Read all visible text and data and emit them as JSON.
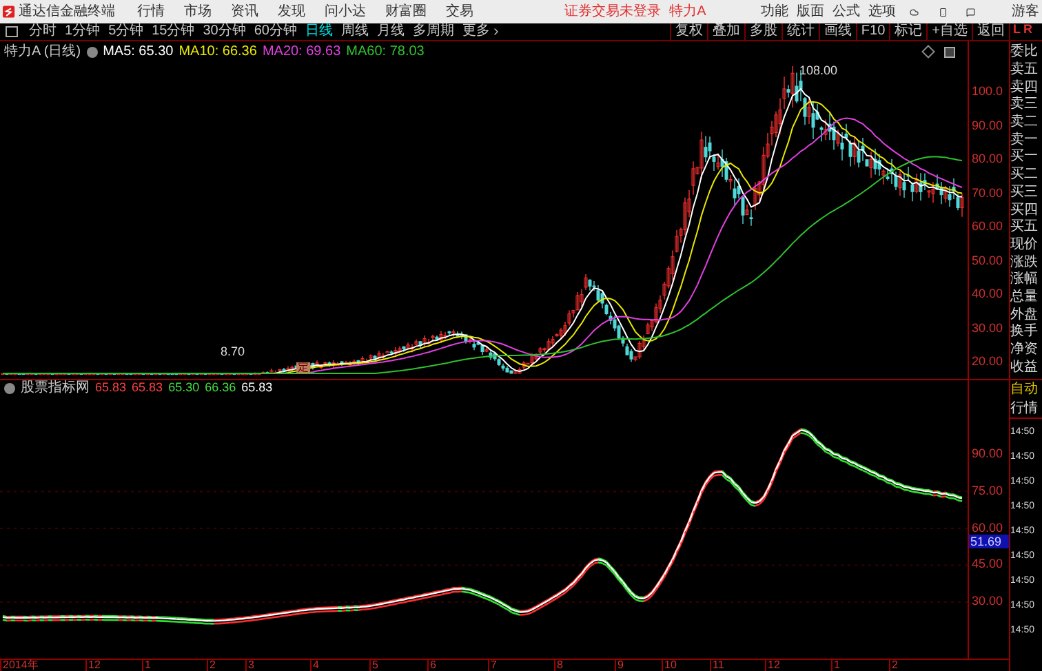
{
  "title_bar": {
    "app_name": "通达信金融终端",
    "menus": [
      "行情",
      "市场",
      "资讯",
      "发现",
      "问小达",
      "财富圈",
      "交易"
    ],
    "login_status": "证券交易未登录",
    "stock_name": "特力A",
    "right_menus": [
      "功能",
      "版面",
      "公式",
      "选项"
    ],
    "user": "游客"
  },
  "period_tabs": [
    {
      "label": "分时",
      "selected": false
    },
    {
      "label": "1分钟",
      "selected": false
    },
    {
      "label": "5分钟",
      "selected": false
    },
    {
      "label": "15分钟",
      "selected": false
    },
    {
      "label": "30分钟",
      "selected": false
    },
    {
      "label": "60分钟",
      "selected": false
    },
    {
      "label": "日线",
      "selected": true
    },
    {
      "label": "周线",
      "selected": false
    },
    {
      "label": "月线",
      "selected": false
    },
    {
      "label": "多周期",
      "selected": false
    },
    {
      "label": "更多",
      "selected": false
    }
  ],
  "tools": [
    "复权",
    "叠加",
    "多股",
    "统计",
    "画线",
    "F10",
    "标记",
    "+自选",
    "返回"
  ],
  "corner_marks": [
    "L",
    "R"
  ],
  "main_chart": {
    "title": "特力A (日线)",
    "ma": [
      {
        "label": "MA5: 65.30",
        "color": "#ffffff"
      },
      {
        "label": "MA10: 66.36",
        "color": "#e8e800"
      },
      {
        "label": "MA20: 69.63",
        "color": "#e040e0"
      },
      {
        "label": "MA60: 78.03",
        "color": "#30c030"
      }
    ],
    "high_label": "108.00",
    "low_label": "8.70",
    "marker": "定",
    "axis": [
      "100.0",
      "90.00",
      "80.00",
      "70.00",
      "60.00",
      "50.00",
      "40.00",
      "30.00",
      "20.00"
    ]
  },
  "indicator": {
    "title": "股票指标网",
    "values": [
      {
        "text": "65.83",
        "color": "#ff4040"
      },
      {
        "text": "65.83",
        "color": "#ff4040"
      },
      {
        "text": "65.30",
        "color": "#40e040"
      },
      {
        "text": "66.36",
        "color": "#40e040"
      },
      {
        "text": "65.83",
        "color": "#ffffff"
      }
    ],
    "axis": [
      "90.00",
      "75.00",
      "60.00",
      "45.00",
      "30.00"
    ],
    "current_value": "51.69"
  },
  "quote_panel": {
    "labels": [
      "委比",
      "卖五",
      "卖四",
      "卖三",
      "卖二",
      "卖一",
      "买一",
      "买二",
      "买三",
      "买四",
      "买五",
      "现价",
      "涨跌",
      "涨幅",
      "总量",
      "外盘",
      "换手",
      "净资",
      "收益"
    ],
    "mode": "自动",
    "tab": "行情",
    "times": [
      "14:50",
      "14:50",
      "14:50",
      "14:50",
      "14:50",
      "14:50",
      "14:50",
      "14:50",
      "14:50"
    ]
  },
  "date_axis": [
    "2014年",
    "12",
    "1",
    "2",
    "3",
    "4",
    "5",
    "6",
    "7",
    "8",
    "9",
    "10",
    "11",
    "12",
    "1",
    "2"
  ]
}
